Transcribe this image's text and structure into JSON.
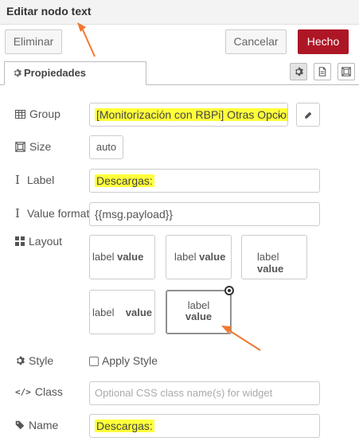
{
  "header": {
    "title": "Editar nodo text"
  },
  "actions": {
    "delete_label": "Eliminar",
    "cancel_label": "Cancelar",
    "done_label": "Hecho"
  },
  "tabs": [
    {
      "label": "Propiedades"
    }
  ],
  "form": {
    "group_label": "Group",
    "group_value": "[Monitorización con RBPi] Otras Opcior",
    "size_label": "Size",
    "size_value": "auto",
    "label_label": "Label",
    "label_value": "Descargas:",
    "value_format_label": "Value format",
    "value_format_value": "{{msg.payload}}",
    "layout_label": "Layout",
    "layout_options": [
      {
        "label": "label",
        "value": "value"
      },
      {
        "label": "label",
        "value": "value"
      },
      {
        "label": "label",
        "value": "value"
      },
      {
        "label": "label",
        "value": "value"
      },
      {
        "label": "label",
        "value": "value"
      }
    ],
    "style_label": "Style",
    "apply_style_label": "Apply Style",
    "class_label": "Class",
    "class_placeholder": "Optional CSS class name(s) for widget",
    "name_label": "Name",
    "name_value": "Descargas:"
  },
  "colors": {
    "primary": "#ad1625",
    "highlight": "#ffff3a",
    "annotation": "#f07830"
  },
  "icons": [
    "cog-icon",
    "file-icon",
    "frame-icon",
    "table-icon",
    "size-icon",
    "text-cursor-icon",
    "grid-icon",
    "code-icon",
    "tag-icon",
    "pencil-icon",
    "chevron-down-icon"
  ]
}
